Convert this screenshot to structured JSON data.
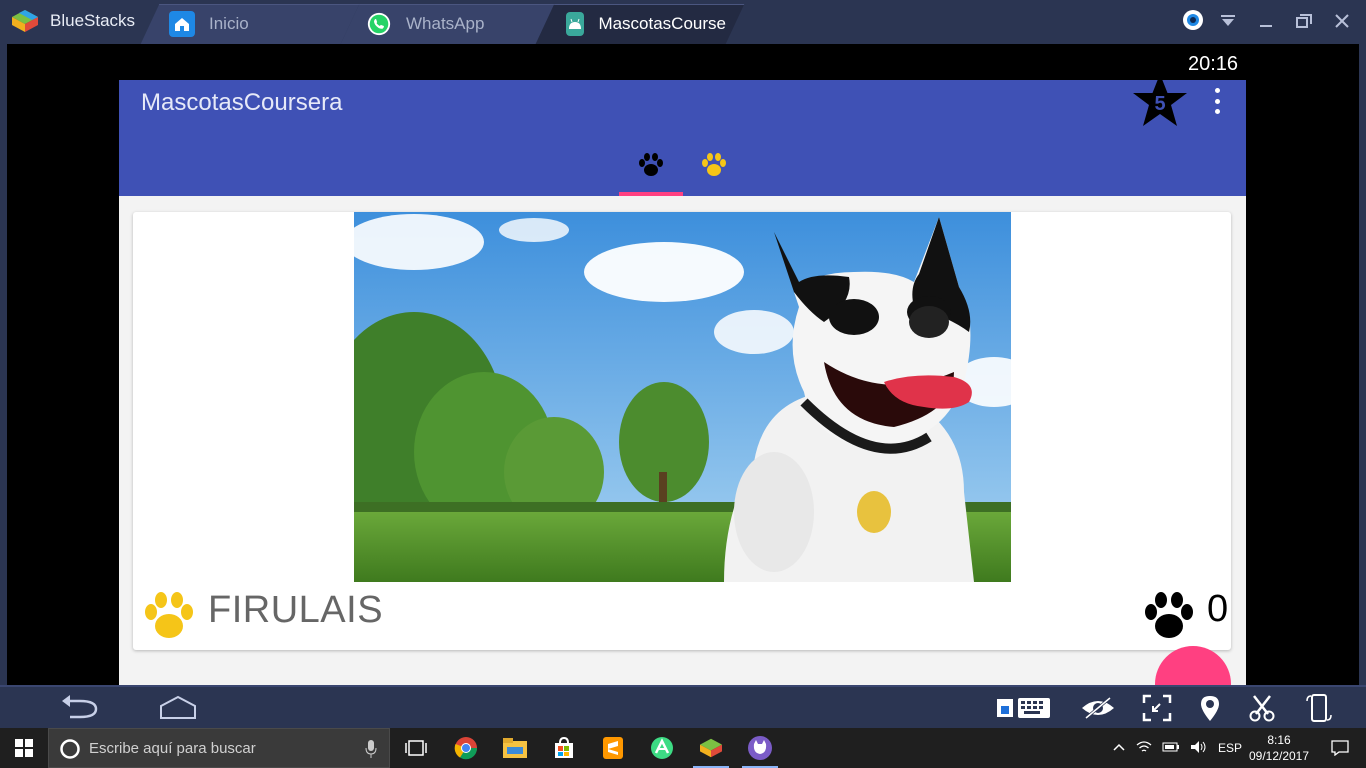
{
  "bluestacks": {
    "brand": "BlueStacks",
    "tabs": [
      {
        "label": "Inicio",
        "icon": "home-icon"
      },
      {
        "label": "WhatsApp",
        "icon": "whatsapp-icon"
      },
      {
        "label": "MascotasCourse",
        "icon": "android-app-icon"
      }
    ],
    "window_controls": [
      "account-icon",
      "dropdown-icon",
      "minimize-icon",
      "maximize-icon",
      "close-icon"
    ],
    "clock": "20:16"
  },
  "app": {
    "title": "MascotasCoursera",
    "favorites_count": "5",
    "tabs": [
      {
        "icon": "paw-black-icon",
        "selected": true
      },
      {
        "icon": "paw-yellow-icon",
        "selected": false
      }
    ],
    "colors": {
      "primary": "#3f51b5",
      "accent": "#ff4081",
      "paw_yellow": "#f5c518"
    },
    "card": {
      "pet_name": "FIRULAIS",
      "likes": "0"
    }
  },
  "bottom_toolbar": {
    "icons": [
      "back-icon",
      "home-icon",
      "keyboard-icon",
      "eye-icon",
      "fullscreen-icon",
      "location-icon",
      "scissors-icon",
      "rotate-icon"
    ]
  },
  "taskbar": {
    "search_placeholder": "Escribe aquí para buscar",
    "language": "ESP",
    "time": "8:16",
    "date": "09/12/2017"
  }
}
